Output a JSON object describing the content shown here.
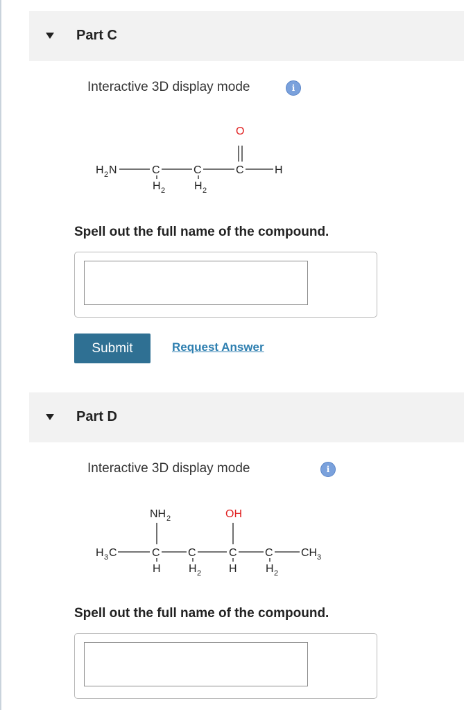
{
  "partC": {
    "title": "Part C",
    "mode_label": "Interactive 3D display mode",
    "info_icon": "i",
    "molecule": {
      "h2n": "H",
      "h2n_sub": "2",
      "h2n_n": "N",
      "c1": "C",
      "c1_h": "H",
      "c1_sub": "2",
      "c2": "C",
      "c2_h": "H",
      "c2_sub": "2",
      "c3": "C",
      "o": "O",
      "h_end": "H"
    },
    "prompt": "Spell out the full name of the compound.",
    "input_value": "",
    "submit_label": "Submit",
    "request_label": "Request Answer"
  },
  "partD": {
    "title": "Part D",
    "mode_label": "Interactive 3D display mode",
    "info_icon": "i",
    "molecule": {
      "h3c_h": "H",
      "h3c_sub": "3",
      "h3c_c": "C",
      "nh2_n": "NH",
      "nh2_sub": "2",
      "oh": "OH",
      "c1": "C",
      "c1_h": "H",
      "c2": "C",
      "c2_h": "H",
      "c2_sub": "2",
      "c3": "C",
      "c3_h": "H",
      "c4": "C",
      "c4_h": "H",
      "c4_sub": "2",
      "ch3_c": "CH",
      "ch3_sub": "3"
    },
    "prompt": "Spell out the full name of the compound.",
    "input_value": ""
  },
  "colors": {
    "accent": "#2f7093",
    "link": "#2e7fb0",
    "oxygen": "#e02020",
    "info": "#7aa1dc"
  }
}
